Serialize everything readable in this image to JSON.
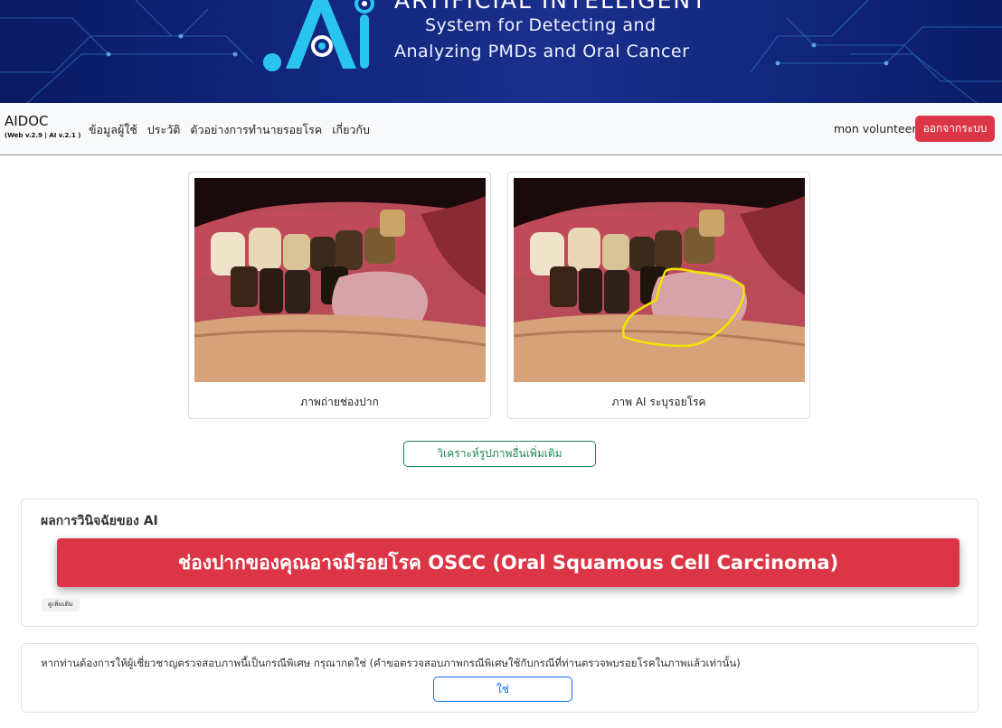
{
  "banner": {
    "title": "ARTIFICIAL INTELLIGENT",
    "subtitle_line1": "System for Detecting and",
    "subtitle_line2": "Analyzing PMDs and Oral Cancer",
    "logo_text": ".Ai",
    "background_color": "#13287f",
    "logo_color": "#29c4ef"
  },
  "navbar": {
    "brand": "AIDOC",
    "version": "(Web v.2.9 | AI v.2.1 )",
    "links": [
      "ข้อมูลผู้ใช้",
      "ประวัติ",
      "ตัวอย่างการทำนายรอยโรค",
      "เกี่ยวกับ"
    ],
    "user_name": "mon volunteer",
    "logout_label": "ออกจากระบบ"
  },
  "images": {
    "original_caption": "ภาพถ่ายช่องปาก",
    "ai_caption": "ภาพ AI ระบุรอยโรค",
    "highlight_color": "#f2e600"
  },
  "analyze_more_label": "วิเคราะห์รูปภาพอื่นเพิ่มเติม",
  "result": {
    "title": "ผลการวินิจฉัยของ AI",
    "diagnosis": "ช่องปากของคุณอาจมีรอยโรค OSCC (Oral Squamous Cell Carcinoma)",
    "more_label": "ดูเพิ่มเติม",
    "alert_color": "#dc3545"
  },
  "expert": {
    "prompt": "หากท่านต้องการให้ผู้เชี่ยวชาญตรวจสอบภาพนี้เป็นกรณีพิเศษ กรุณากดใช่ (คำขอตรวจสอบภาพกรณีพิเศษใช้กับกรณีที่ท่านตรวจพบรอยโรคในภาพแล้วเท่านั้น)",
    "yes_label": "ใช่"
  }
}
